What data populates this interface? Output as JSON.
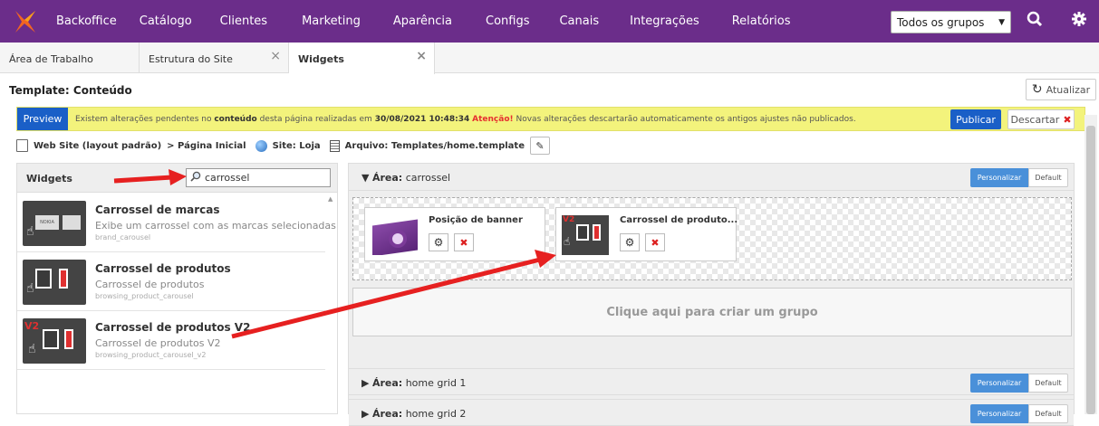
{
  "nav": {
    "items": [
      "Backoffice",
      "Catálogo",
      "Clientes",
      "Marketing",
      "Aparência",
      "Configs",
      "Canais",
      "Integrações",
      "Relatórios"
    ],
    "group_select": "Todos os grupos"
  },
  "tabs": [
    {
      "label": "Área de Trabalho"
    },
    {
      "label": "Estrutura do Site"
    },
    {
      "label": "Widgets"
    }
  ],
  "page": {
    "title": "Template: Conteúdo",
    "refresh_label": "Atualizar"
  },
  "alert": {
    "preview_label": "Preview",
    "text_prefix": "Existem alterações pendentes no ",
    "text_bold": "conteúdo",
    "text_mid": " desta página realizadas em ",
    "date": "30/08/2021 10:48:34",
    "warn": "Atenção!",
    "text_suffix": " Novas alterações descartarão automaticamente os antigos ajustes não publicados.",
    "publish_label": "Publicar",
    "discard_label": "Descartar"
  },
  "breadcrumb": {
    "layout": "Web Site (layout padrão)",
    "page": "> Página Inicial",
    "site": "Site: Loja",
    "file": "Arquivo: Templates/home.template"
  },
  "widgets_panel": {
    "title": "Widgets",
    "search_value": "carrossel",
    "items": [
      {
        "name": "Carrossel de marcas",
        "desc": "Exibe um carrossel com as marcas selecionadas",
        "code": "brand_carousel"
      },
      {
        "name": "Carrossel de produtos",
        "desc": "Carrossel de produtos",
        "code": "browsing_product_carousel"
      },
      {
        "name": "Carrossel de produtos V2",
        "desc": "Carrossel de produtos V2",
        "code": "browsing_product_carousel_v2"
      }
    ]
  },
  "areas": [
    {
      "label": "Área:",
      "name": "carrossel",
      "pers": "Personalizar",
      "def": "Default"
    },
    {
      "label": "Área:",
      "name": "home grid 1",
      "pers": "Personalizar",
      "def": "Default"
    },
    {
      "label": "Área:",
      "name": "home grid 2",
      "pers": "Personalizar",
      "def": "Default"
    }
  ],
  "cards": [
    {
      "title": "Posição de banner"
    },
    {
      "title": "Carrossel de produto..."
    }
  ],
  "create_group": "Clique aqui para criar um grupo",
  "colors": {
    "nav_bg": "#6b2d8a",
    "primary": "#1a5fc7",
    "alert_bg": "#f3f37c",
    "warn": "#e63030",
    "arrow": "#e62020"
  }
}
